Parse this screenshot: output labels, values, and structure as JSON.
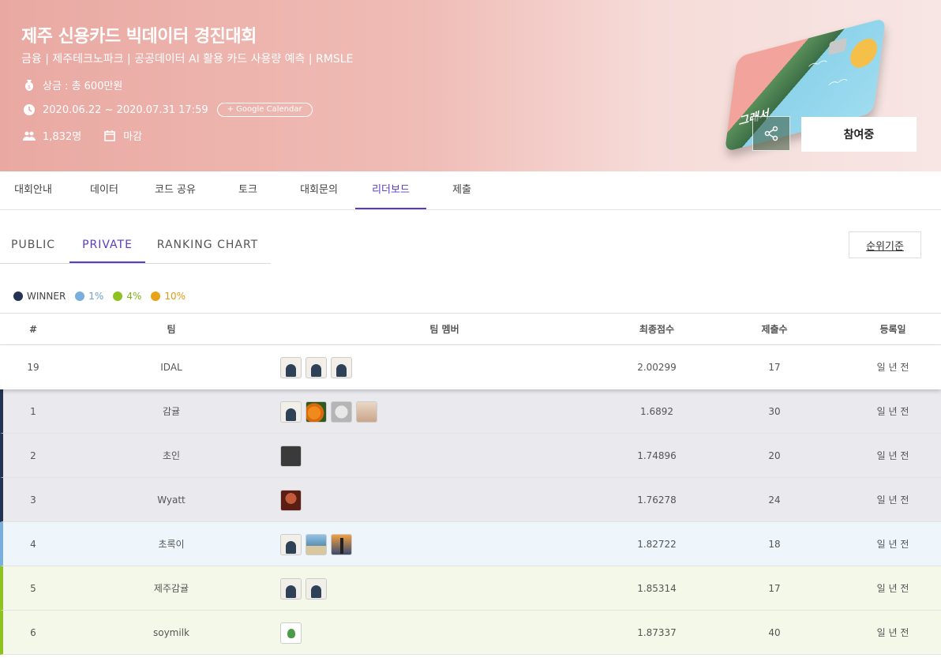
{
  "competition": {
    "title": "제주 신용카드 빅데이터 경진대회",
    "subtitle": "금융 | 제주테크노파크 | 공공데이터 AI 활용 카드 사용량 예측 | RMSLE",
    "prize": "상금 : 총 600만원",
    "period": "2020.06.22 ~ 2020.07.31 17:59",
    "google_calendar": "+ Google Calendar",
    "participants": "1,832명",
    "status": "마감",
    "join_label": "참여중",
    "card_logo": "그래서"
  },
  "top_tabs": [
    "대회안내",
    "데이터",
    "코드 공유",
    "토크",
    "대회문의",
    "리더보드",
    "제출"
  ],
  "top_tabs_active": "리더보드",
  "sub_tabs": [
    "PUBLIC",
    "PRIVATE",
    "RANKING CHART"
  ],
  "sub_tabs_active": "PRIVATE",
  "rank_criteria_label": "순위기준",
  "legend": [
    {
      "label": "WINNER",
      "color": "#233353"
    },
    {
      "label": "1%",
      "color": "#7aaedc"
    },
    {
      "label": "4%",
      "color": "#8dc21f"
    },
    {
      "label": "10%",
      "color": "#e8a317"
    }
  ],
  "table": {
    "headers": [
      "#",
      "팀",
      "팀 멤버",
      "최종점수",
      "제출수",
      "등록일"
    ],
    "my_row": {
      "rank": "19",
      "team": "IDAL",
      "members": [
        "default",
        "default",
        "default"
      ],
      "score": "2.00299",
      "submissions": "17",
      "date": "일 년 전"
    },
    "rows": [
      {
        "rank": "1",
        "team": "감귤",
        "tier": "winner",
        "members": [
          "default",
          "orange",
          "white",
          "face"
        ],
        "score": "1.6892",
        "submissions": "30",
        "date": "일 년 전"
      },
      {
        "rank": "2",
        "team": "초인",
        "tier": "winner",
        "members": [
          "dark"
        ],
        "score": "1.74896",
        "submissions": "20",
        "date": "일 년 전"
      },
      {
        "rank": "3",
        "team": "Wyatt",
        "tier": "winner",
        "members": [
          "red"
        ],
        "score": "1.76278",
        "submissions": "24",
        "date": "일 년 전"
      },
      {
        "rank": "4",
        "team": "초록이",
        "tier": "p1",
        "members": [
          "default",
          "sea",
          "tower"
        ],
        "score": "1.82722",
        "submissions": "18",
        "date": "일 년 전"
      },
      {
        "rank": "5",
        "team": "제주감귤",
        "tier": "p4",
        "members": [
          "default",
          "default"
        ],
        "score": "1.85314",
        "submissions": "17",
        "date": "일 년 전"
      },
      {
        "rank": "6",
        "team": "soymilk",
        "tier": "p4",
        "members": [
          "plant"
        ],
        "score": "1.87337",
        "submissions": "40",
        "date": "일 년 전"
      }
    ]
  }
}
